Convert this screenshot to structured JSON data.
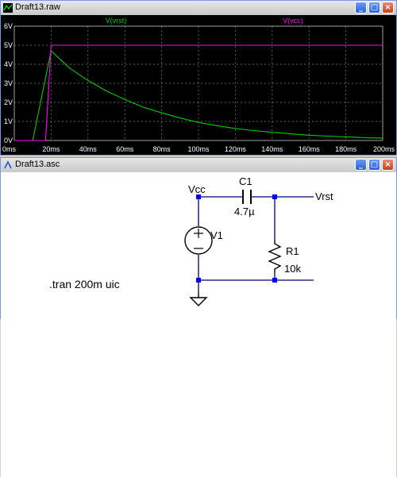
{
  "waveform_window": {
    "title": "Draft13.raw",
    "buttons": {
      "minimize": "_",
      "maximize": "□",
      "close": "×"
    },
    "trace_labels": [
      "V(vrst)",
      "V(vcc)"
    ],
    "y_ticks": [
      "6V",
      "5V",
      "4V",
      "3V",
      "2V",
      "1V",
      "0V"
    ],
    "x_ticks": [
      "0ms",
      "20ms",
      "40ms",
      "60ms",
      "80ms",
      "100ms",
      "120ms",
      "140ms",
      "160ms",
      "180ms",
      "200ms"
    ]
  },
  "schematic_window": {
    "title": "Draft13.asc",
    "buttons": {
      "minimize": "_",
      "maximize": "□",
      "close": "×"
    },
    "labels": {
      "vcc_net": "Vcc",
      "vrst_net": "Vrst",
      "c1_name": "C1",
      "c1_value": "4.7µ",
      "v1_name": "V1",
      "r1_name": "R1",
      "r1_value": "10k",
      "directive": ".tran 200m uic"
    }
  },
  "chart_data": {
    "type": "line",
    "xlabel": "",
    "ylabel": "",
    "xlim": [
      0,
      200
    ],
    "ylim": [
      0,
      6
    ],
    "x_units": "ms",
    "y_units": "V",
    "grid": true,
    "legend": "top",
    "series": [
      {
        "name": "V(vrst)",
        "color": "#00cc00",
        "x": [
          0,
          10,
          20,
          30,
          40,
          50,
          60,
          70,
          80,
          90,
          100,
          110,
          120,
          130,
          140,
          150,
          160,
          170,
          180,
          190,
          200
        ],
        "y": [
          0,
          0,
          4.7,
          3.8,
          3.15,
          2.6,
          2.15,
          1.75,
          1.45,
          1.18,
          0.95,
          0.78,
          0.63,
          0.52,
          0.43,
          0.35,
          0.28,
          0.23,
          0.19,
          0.15,
          0.12
        ]
      },
      {
        "name": "V(vcc)",
        "color": "#ff00ff",
        "x": [
          0,
          17,
          20,
          200
        ],
        "y": [
          0,
          0,
          5.0,
          5.0
        ]
      }
    ]
  }
}
